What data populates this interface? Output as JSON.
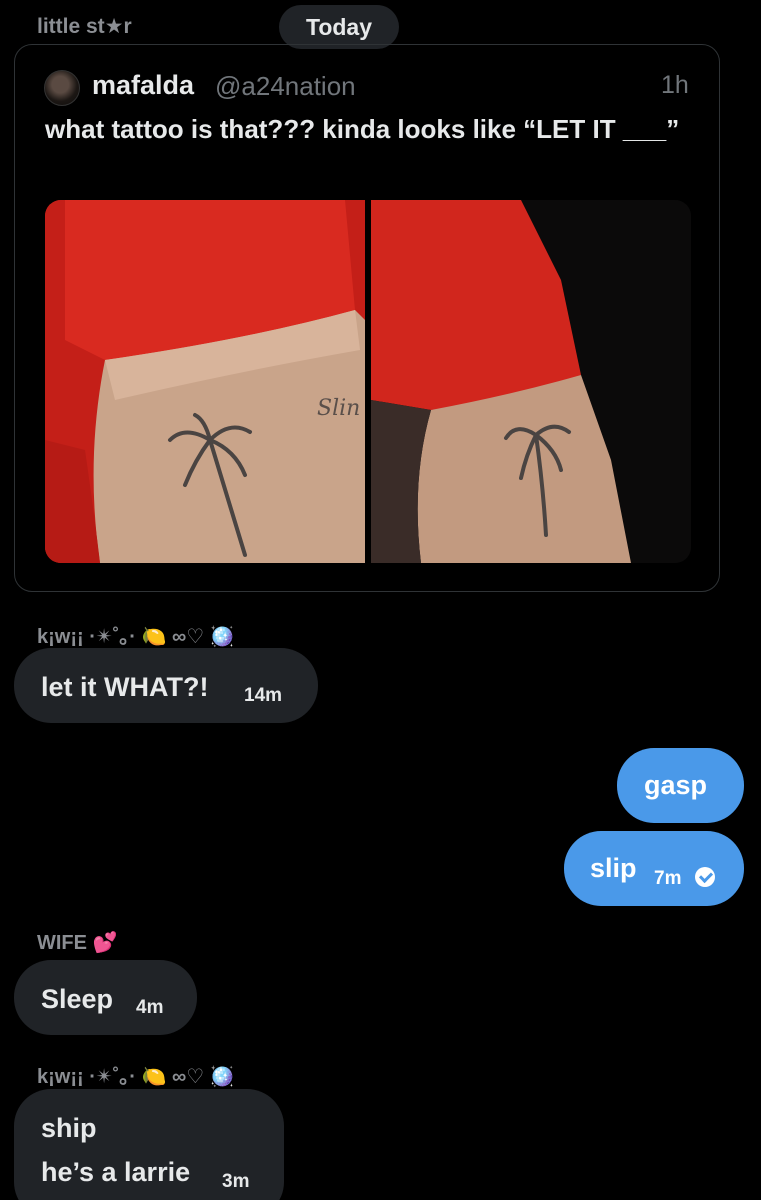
{
  "header": {
    "previous_sender": "little st★r",
    "date_separator": "Today"
  },
  "quoted_tweet": {
    "display_name": "mafalda",
    "handle": "@a24nation",
    "time": "1h",
    "text": "what tattoo is that??? kinda looks like “LET IT ___”",
    "avatar_icon": "profile-avatar",
    "media_text": "Slin"
  },
  "messages": [
    {
      "sender": "k¡w¡¡ ·✴˚｡· 🍋 ∞♡ 🪩",
      "lines": [
        "let it WHAT?!"
      ],
      "time": "14m",
      "direction": "incoming"
    },
    {
      "sender": "",
      "lines": [
        "gasp"
      ],
      "time": "",
      "direction": "outgoing"
    },
    {
      "sender": "",
      "lines": [
        "slip"
      ],
      "time": "7m",
      "direction": "outgoing",
      "status_icon": "seen-check-icon"
    },
    {
      "sender": "WIFE 💕",
      "lines": [
        "Sleep"
      ],
      "time": "4m",
      "direction": "incoming"
    },
    {
      "sender": "k¡w¡¡ ·✴˚｡· 🍋 ∞♡ 🪩",
      "lines": [
        "ship",
        "he’s a larrie"
      ],
      "time": "3m",
      "direction": "incoming"
    }
  ],
  "colors": {
    "background": "#000000",
    "incoming_bubble": "#202327",
    "outgoing_bubble": "#4a99e9",
    "muted_text": "#71767b"
  }
}
